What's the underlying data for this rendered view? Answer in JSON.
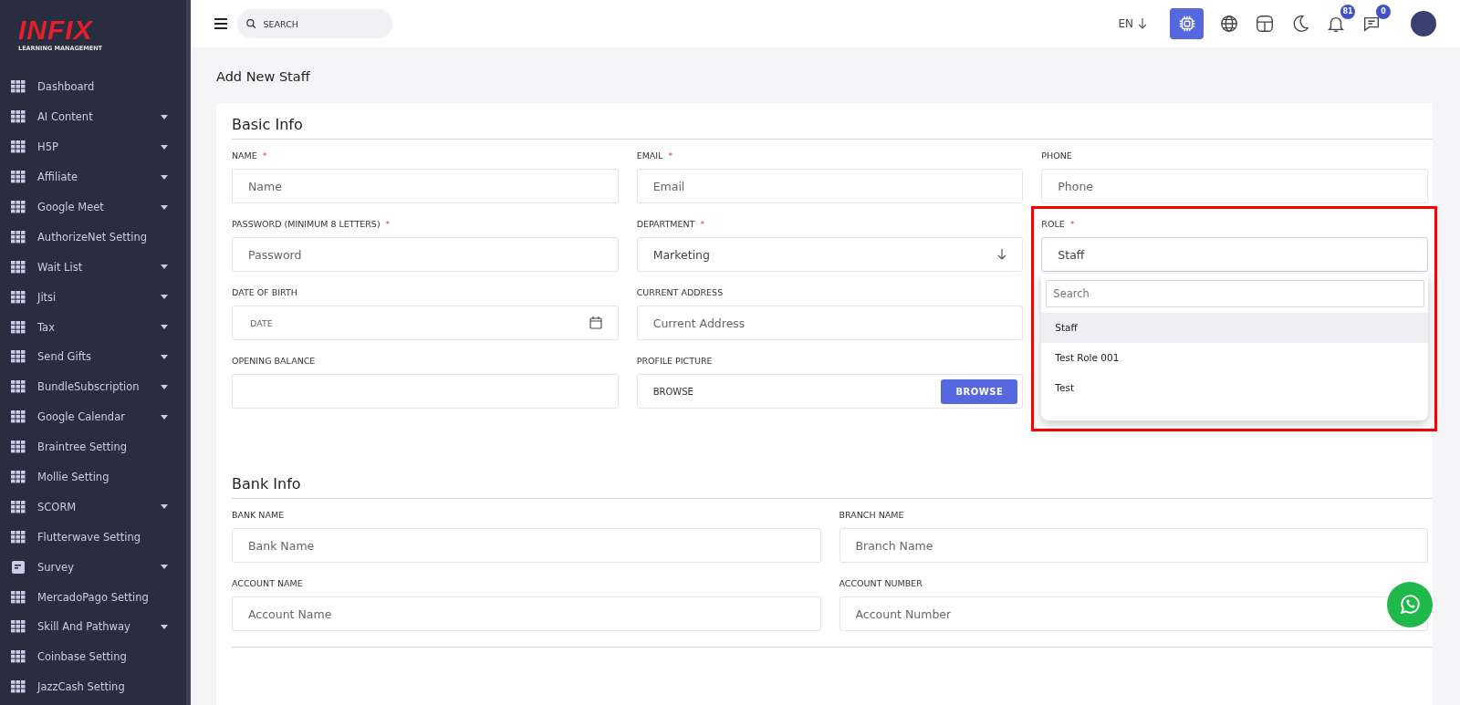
{
  "sidebar": {
    "logo": {
      "title": "INFIX",
      "subtitle": "LEARNING MANAGEMENT"
    },
    "items": [
      {
        "label": "Dashboard",
        "kind": "grid",
        "has_submenu": false
      },
      {
        "label": "AI Content",
        "kind": "grid",
        "has_submenu": true
      },
      {
        "label": "H5P",
        "kind": "grid",
        "has_submenu": true
      },
      {
        "label": "Affiliate",
        "kind": "grid",
        "has_submenu": true
      },
      {
        "label": "Google Meet",
        "kind": "grid",
        "has_submenu": true
      },
      {
        "label": "AuthorizeNet Setting",
        "kind": "grid",
        "has_submenu": false
      },
      {
        "label": "Wait List",
        "kind": "grid",
        "has_submenu": true
      },
      {
        "label": "Jitsi",
        "kind": "grid",
        "has_submenu": true
      },
      {
        "label": "Tax",
        "kind": "grid",
        "has_submenu": true
      },
      {
        "label": "Send Gifts",
        "kind": "grid",
        "has_submenu": true
      },
      {
        "label": "BundleSubscription",
        "kind": "grid",
        "has_submenu": true
      },
      {
        "label": "Google Calendar",
        "kind": "grid",
        "has_submenu": true
      },
      {
        "label": "Braintree Setting",
        "kind": "grid",
        "has_submenu": false
      },
      {
        "label": "Mollie Setting",
        "kind": "grid",
        "has_submenu": false
      },
      {
        "label": "SCORM",
        "kind": "grid",
        "has_submenu": true
      },
      {
        "label": "Flutterwave Setting",
        "kind": "grid",
        "has_submenu": false
      },
      {
        "label": "Survey",
        "kind": "document",
        "has_submenu": true
      },
      {
        "label": "MercadoPago Setting",
        "kind": "grid",
        "has_submenu": false
      },
      {
        "label": "Skill And Pathway",
        "kind": "grid",
        "has_submenu": true
      },
      {
        "label": "Coinbase Setting",
        "kind": "grid",
        "has_submenu": false
      },
      {
        "label": "JazzCash Setting",
        "kind": "grid",
        "has_submenu": false
      }
    ]
  },
  "topbar": {
    "search": {
      "placeholder": "SEARCH"
    },
    "language": "EN",
    "notifications_badge": "81",
    "messages_badge": "0"
  },
  "page_title": "Add New Staff",
  "basic_info": {
    "title": "Basic Info",
    "fields": [
      {
        "label": "NAME",
        "required_mark": "*",
        "kind": "text",
        "placeholder": "Name"
      },
      {
        "label": "EMAIL",
        "required_mark": "*",
        "kind": "text",
        "placeholder": "Email"
      },
      {
        "label": "PHONE",
        "kind": "text",
        "placeholder": "Phone"
      },
      {
        "label": "PASSWORD (MINIMUM 8 LETTERS)",
        "required_mark": "*",
        "kind": "text",
        "placeholder": "Password"
      },
      {
        "label": "DEPARTMENT",
        "required_mark": "*",
        "kind": "select",
        "value": "Marketing"
      },
      {
        "label": "ROLE",
        "required_mark": "*",
        "kind": "dropdown",
        "value": "Staff"
      },
      {
        "label": "DATE OF BIRTH",
        "kind": "date",
        "placeholder": "DATE"
      },
      {
        "label": "CURRENT ADDRESS",
        "kind": "text",
        "placeholder": "Current Address"
      },
      {
        "label": "OPENING BALANCE",
        "kind": "text"
      },
      {
        "label": "PROFILE PICTURE",
        "kind": "file",
        "placeholder": "BROWSE",
        "button": "BROWSE"
      }
    ]
  },
  "role_dropdown": {
    "highlighted": true,
    "search_placeholder": "Search",
    "options": [
      {
        "label": "Staff",
        "selected": true
      },
      {
        "label": "Test Role 001",
        "selected": false
      },
      {
        "label": "Test",
        "selected": false
      }
    ]
  },
  "bank_info": {
    "title": "Bank Info",
    "fields": [
      {
        "label": "BANK NAME",
        "placeholder": "Bank Name"
      },
      {
        "label": "BRANCH NAME",
        "placeholder": "Branch Name"
      },
      {
        "label": "ACCOUNT NAME",
        "placeholder": "Account Name"
      },
      {
        "label": "ACCOUNT NUMBER",
        "placeholder": "Account Number"
      }
    ]
  }
}
